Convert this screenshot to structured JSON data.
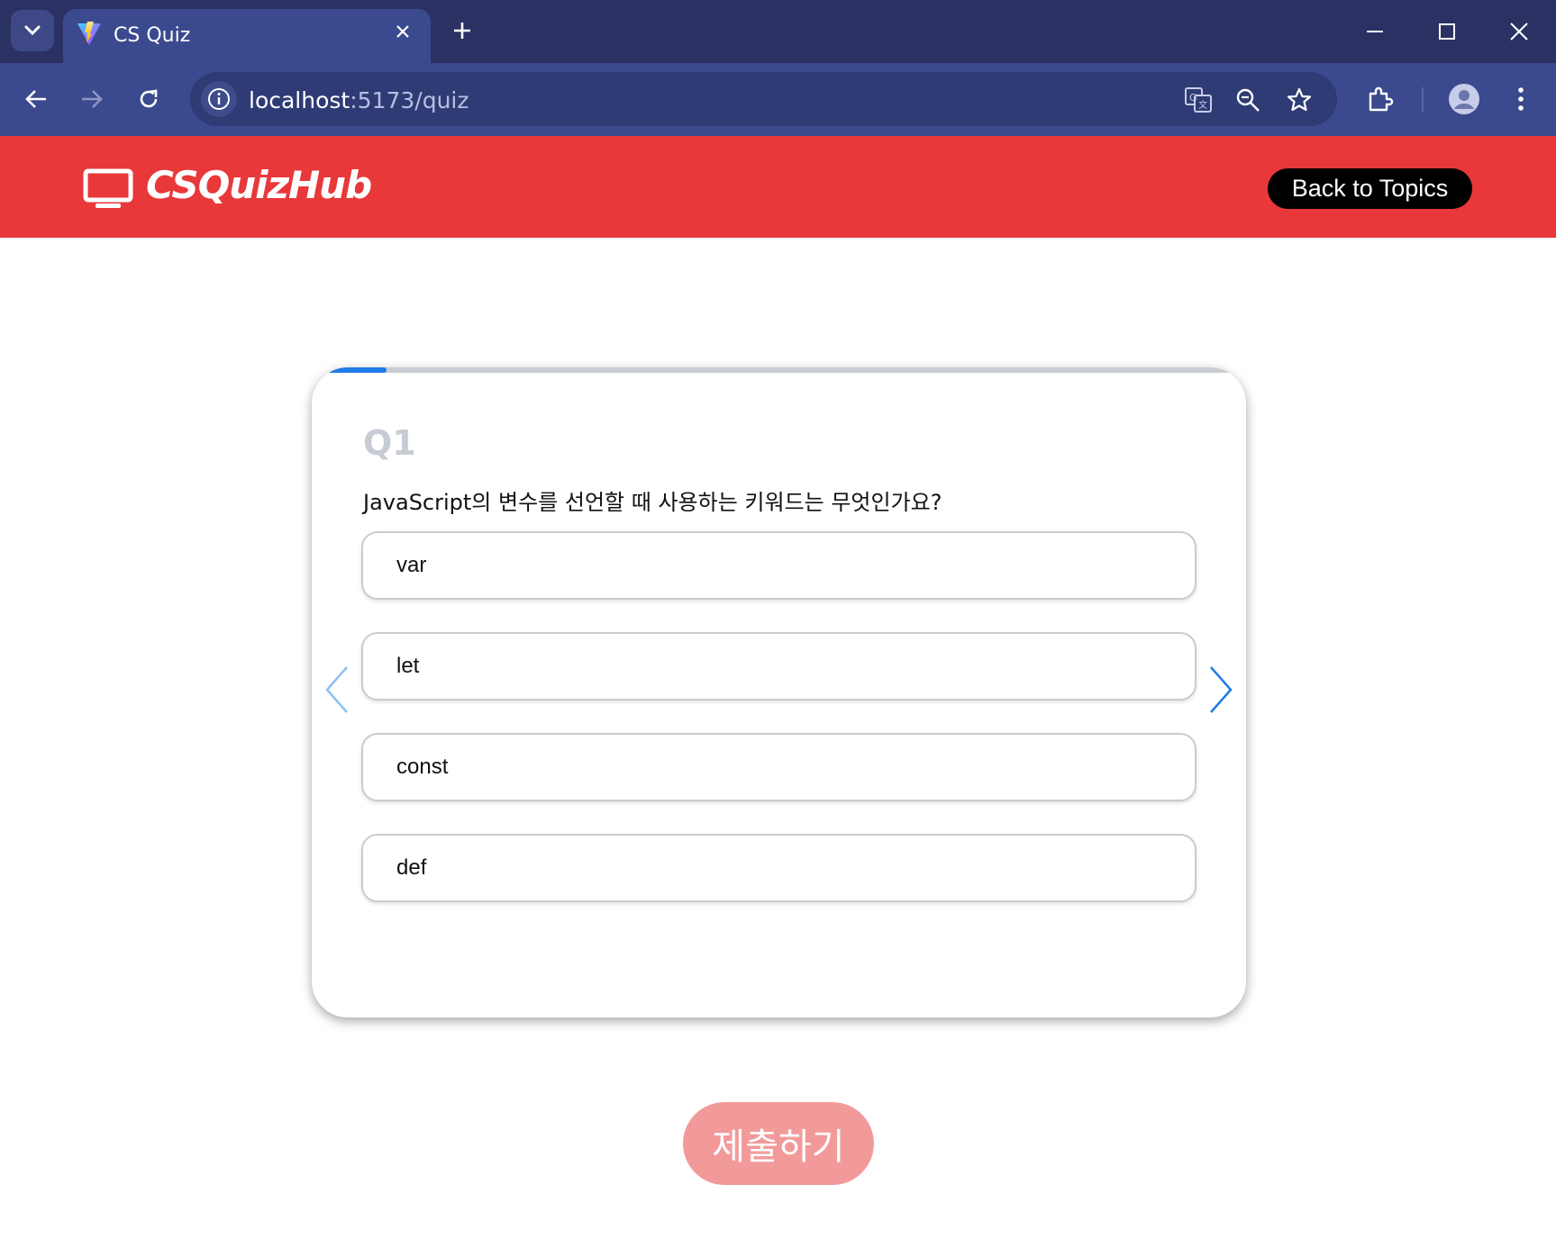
{
  "browser": {
    "tab_title": "CS Quiz",
    "url_host": "localhost",
    "url_path": ":5173/quiz"
  },
  "header": {
    "logo_text": "CSQuizHub",
    "back_label": "Back to Topics"
  },
  "quiz": {
    "progress_fraction": 0.08,
    "question_number": "Q1",
    "question_text": "JavaScript의 변수를 선언할 때 사용하는 키워드는 무엇인가요?",
    "options": [
      "var",
      "let",
      "const",
      "def"
    ]
  },
  "submit_label": "제출하기",
  "colors": {
    "header_bg": "#e8383a",
    "accent": "#1f7be6",
    "submit_bg": "#f29a9a"
  }
}
